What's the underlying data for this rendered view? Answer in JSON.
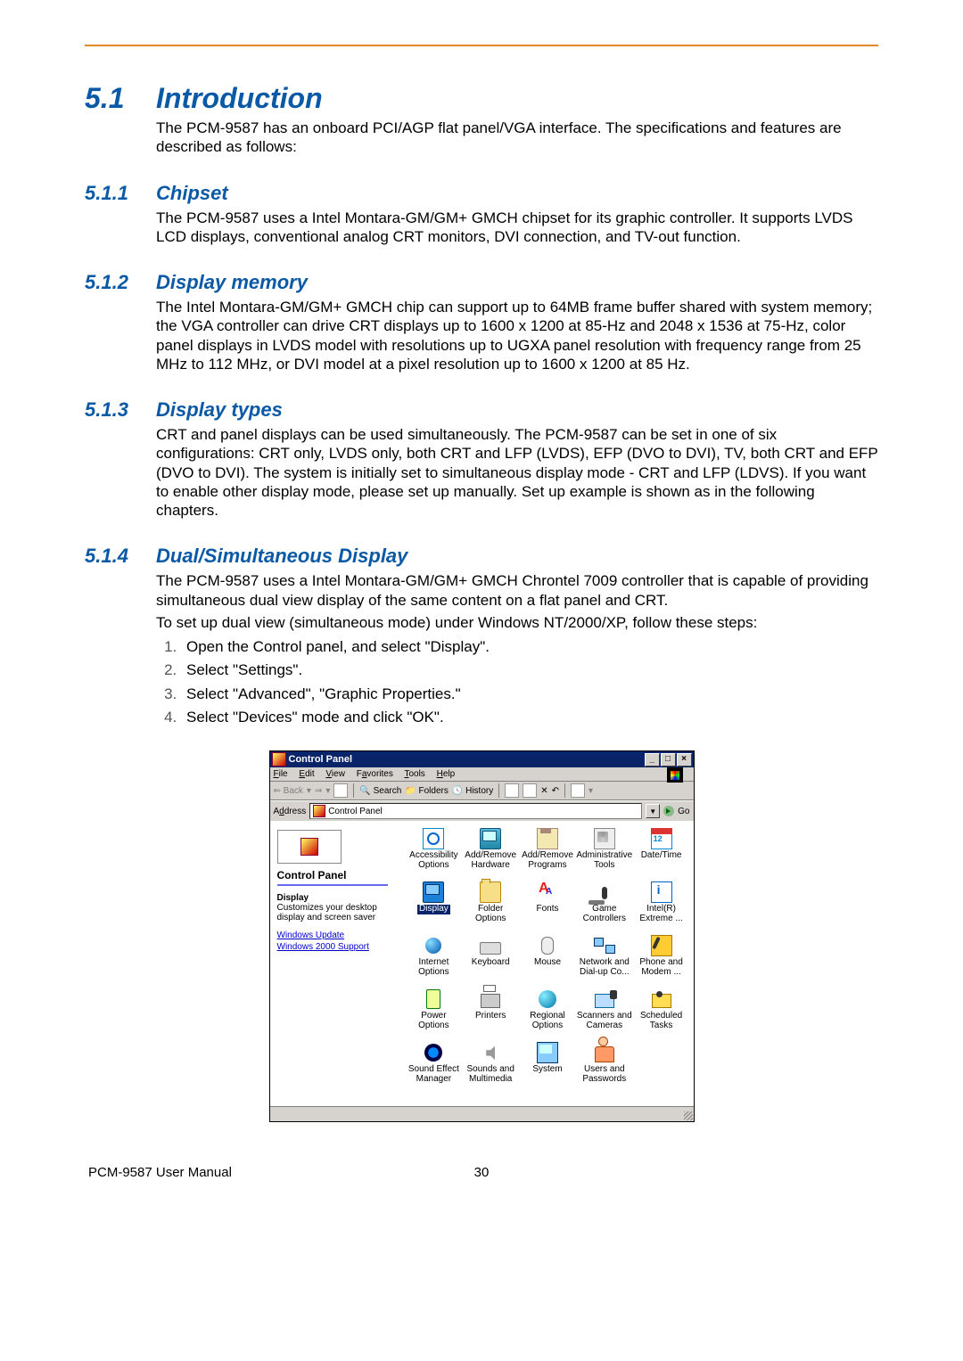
{
  "page": {
    "footer_left": "PCM-9587 User Manual",
    "footer_page": "30"
  },
  "s1": {
    "num": "5.1",
    "title": "Introduction",
    "p1": "The PCM-9587 has an onboard PCI/AGP flat panel/VGA interface. The specifications and features are described as follows:"
  },
  "s11": {
    "num": "5.1.1",
    "title": "Chipset",
    "p1": "The PCM-9587 uses a Intel Montara-GM/GM+ GMCH chipset for its graphic controller. It supports LVDS LCD displays, conventional analog CRT monitors, DVI connection, and TV-out function."
  },
  "s12": {
    "num": "5.1.2",
    "title": "Display memory",
    "p1": "The Intel Montara-GM/GM+ GMCH chip can support  up to 64MB  frame buffer shared with system memory; the VGA controller can drive CRT displays up to 1600 x 1200 at 85-Hz and 2048 x 1536 at 75-Hz, color panel displays in LVDS model with resolutions up to UGXA panel resolution with frequency range from 25 MHz to 112 MHz, or DVI model at a pixel resolution up to 1600 x 1200 at 85 Hz."
  },
  "s13": {
    "num": "5.1.3",
    "title": "Display types",
    "p1": "CRT and panel displays can be used simultaneously. The PCM-9587 can be set in one of six configurations: CRT only, LVDS only, both CRT and LFP (LVDS), EFP (DVO to DVI), TV, both CRT and EFP (DVO to DVI).  The system is initially set to simultaneous display mode - CRT and LFP (LDVS). If you want to enable other display mode, please set up manually. Set up example is shown as in the following chapters."
  },
  "s14": {
    "num": "5.1.4",
    "title": "Dual/Simultaneous Display",
    "p1": "The PCM-9587 uses a Intel Montara-GM/GM+ GMCH Chrontel 7009 controller that is capable of providing simultaneous dual view display of the same content on a flat panel and CRT.",
    "p2": "To set up dual view (simultaneous mode) under Windows NT/2000/XP, follow these steps:",
    "steps": [
      "Open the Control panel, and select \"Display\".",
      "Select \"Settings\".",
      "Select \"Advanced\", \"Graphic Properties.\"",
      "Select \"Devices\" mode and click \"OK\"."
    ]
  },
  "cp": {
    "title": "Control Panel",
    "menu": {
      "file": "File",
      "edit": "Edit",
      "view": "View",
      "fav": "Favorites",
      "tools": "Tools",
      "help": "Help"
    },
    "toolbar": {
      "back": "Back",
      "search": "Search",
      "folders": "Folders",
      "history": "History"
    },
    "address": {
      "label": "Address",
      "value": "Control Panel",
      "go": "Go"
    },
    "side": {
      "title": "Control Panel",
      "subhead": "Display",
      "desc": "Customizes your desktop display and screen saver",
      "link1": "Windows Update",
      "link2": "Windows 2000 Support"
    },
    "icons": [
      {
        "label": "Accessibility Options",
        "g": "g-wheelchair"
      },
      {
        "label": "Add/Remove Hardware",
        "g": "g-mon"
      },
      {
        "label": "Add/Remove Programs",
        "g": "g-box"
      },
      {
        "label": "Administrative Tools",
        "g": "g-tools"
      },
      {
        "label": "Date/Time",
        "g": "g-cal"
      },
      {
        "label": "Display",
        "g": "g-display",
        "selected": true
      },
      {
        "label": "Folder Options",
        "g": "g-folder"
      },
      {
        "label": "Fonts",
        "g": "g-aa"
      },
      {
        "label": "Game Controllers",
        "g": "g-joy"
      },
      {
        "label": "Intel(R) Extreme ...",
        "g": "g-intel"
      },
      {
        "label": "Internet Options",
        "g": "g-globe"
      },
      {
        "label": "Keyboard",
        "g": "g-kbd"
      },
      {
        "label": "Mouse",
        "g": "g-mouse"
      },
      {
        "label": "Network and Dial-up Co...",
        "g": "g-net"
      },
      {
        "label": "Phone and Modem ...",
        "g": "g-phone"
      },
      {
        "label": "Power Options",
        "g": "g-batt"
      },
      {
        "label": "Printers",
        "g": "g-print"
      },
      {
        "label": "Regional Options",
        "g": "g-reg"
      },
      {
        "label": "Scanners and Cameras",
        "g": "g-scan"
      },
      {
        "label": "Scheduled Tasks",
        "g": "g-cam"
      },
      {
        "label": "Sound Effect Manager",
        "g": "g-snd"
      },
      {
        "label": "Sounds and Multimedia",
        "g": "g-spk"
      },
      {
        "label": "System",
        "g": "g-sys"
      },
      {
        "label": "Users and Passwords",
        "g": "g-usr"
      }
    ]
  }
}
